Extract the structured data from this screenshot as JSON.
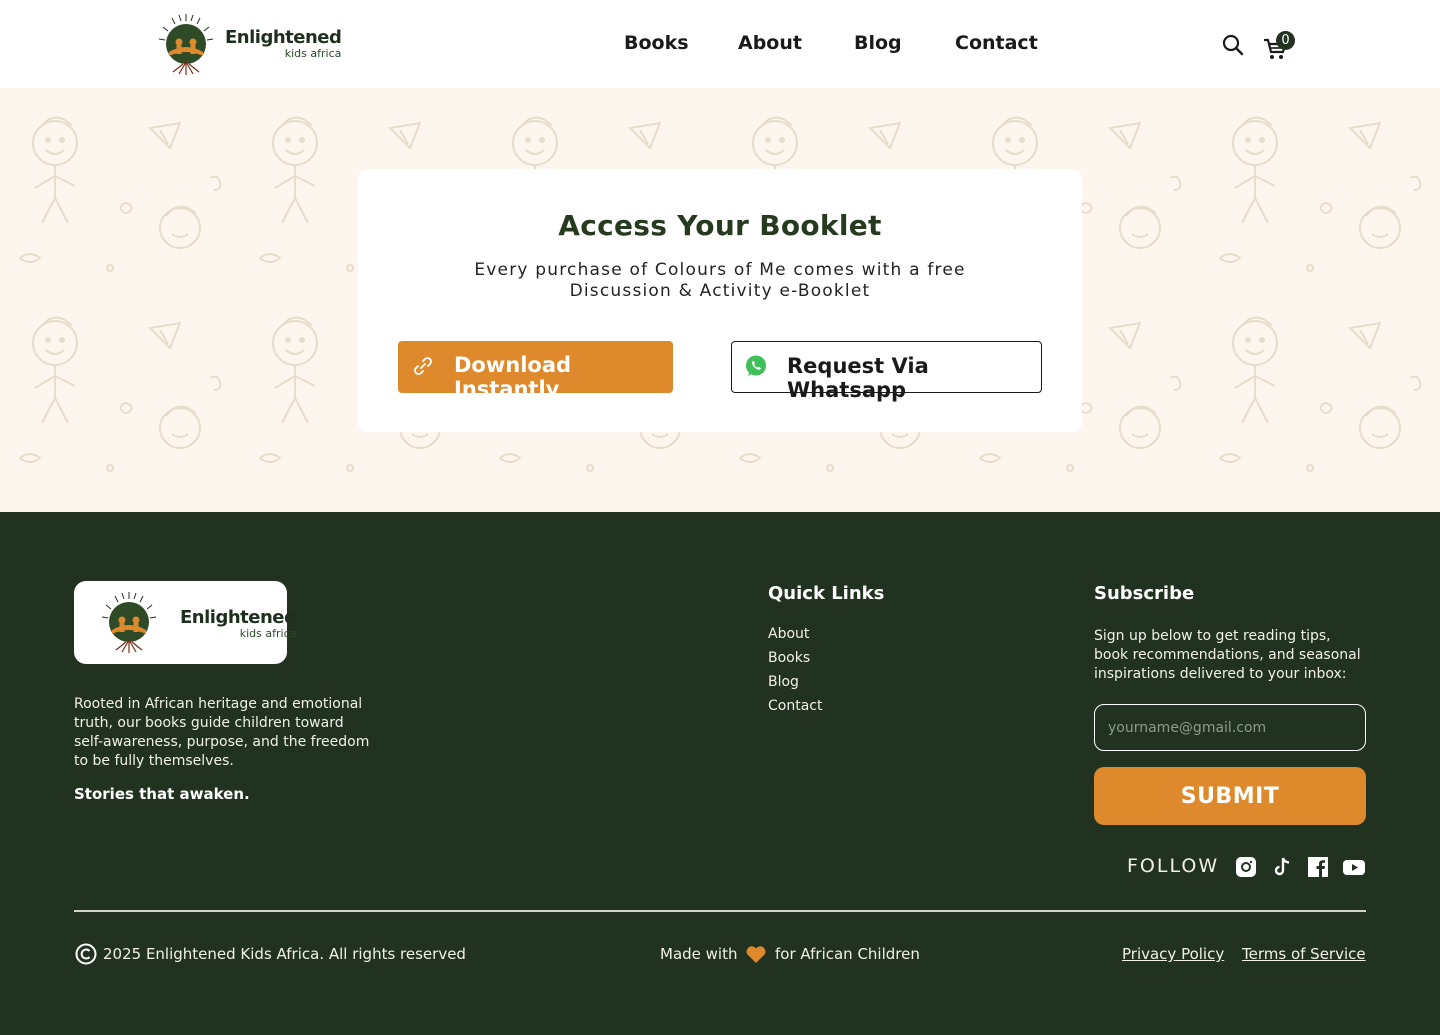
{
  "header": {
    "logo": {
      "line1": "Enlightened",
      "line2": "kids africa"
    },
    "nav": [
      {
        "label": "Books"
      },
      {
        "label": "About"
      },
      {
        "label": "Blog"
      },
      {
        "label": "Contact"
      }
    ],
    "search_icon": "search-icon",
    "cart_icon": "cart-icon",
    "cart_count": "0"
  },
  "hero": {
    "title": "Access Your Booklet",
    "subtitle": "Every purchase of Colours of Me comes with a free Discussion & Activity e-Booklet",
    "download_label": "Download Instantly",
    "download_icon": "link-icon",
    "whatsapp_label": "Request Via Whatsapp",
    "whatsapp_icon": "whatsapp-icon"
  },
  "footer": {
    "logo": {
      "line1": "Enlightened",
      "line2": "kids africa"
    },
    "about_text": "Rooted in African heritage and emotional truth, our books guide children toward self-awareness, purpose, and the freedom to be fully themselves.",
    "tagline": "Stories that awaken.",
    "quick_links_title": "Quick Links",
    "quick_links": [
      {
        "label": "About"
      },
      {
        "label": "Books"
      },
      {
        "label": "Blog"
      },
      {
        "label": "Contact"
      }
    ],
    "subscribe_title": "Subscribe",
    "subscribe_text": "Sign up below to get reading tips, book recommendations, and seasonal inspirations delivered to your inbox:",
    "email_placeholder": "yourname@gmail.com",
    "submit_label": "SUBMIT",
    "follow_label": "FOLLOW",
    "social_icons": [
      "instagram-icon",
      "tiktok-icon",
      "facebook-icon",
      "youtube-icon"
    ],
    "copyright": "2025 Enlightened Kids Africa. All rights reserved",
    "made_with": "Made with",
    "made_for": "for African Children",
    "privacy_label": "Privacy Policy",
    "terms_label": "Terms of Service"
  },
  "colors": {
    "accent_orange": "#de8a2c",
    "footer_green": "#223220",
    "title_green": "#253a1f",
    "hero_bg": "#fdf6ee"
  }
}
